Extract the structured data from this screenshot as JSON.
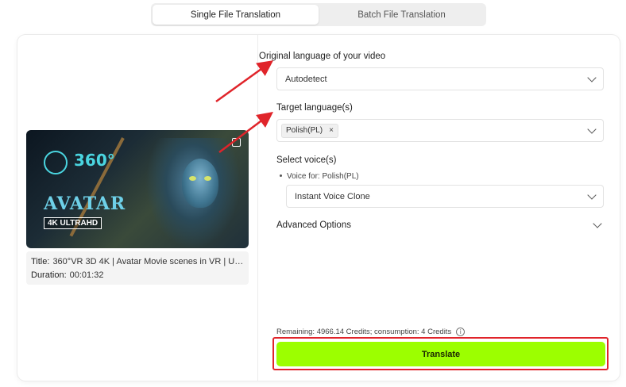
{
  "tabs": [
    {
      "label": "Single File Translation",
      "active": true
    },
    {
      "label": "Batch File Translation",
      "active": false
    }
  ],
  "video": {
    "thumb_text_360": "360°",
    "thumb_logo": "AVATAR",
    "thumb_badge": "4K ULTRAHD",
    "title_label": "Title:",
    "title_value": "360°VR 3D 4K | Avatar Movie scenes in VR | Under...",
    "duration_label": "Duration:",
    "duration_value": "00:01:32"
  },
  "form": {
    "original_language_label": "Original language of your video",
    "original_language_value": "Autodetect",
    "target_language_label": "Target language(s)",
    "target_chip": "Polish(PL)",
    "chip_remove": "×",
    "select_voice_label": "Select voice(s)",
    "voice_for": "Voice for: Polish(PL)",
    "voice_value": "Instant Voice Clone",
    "advanced_options": "Advanced Options"
  },
  "footer": {
    "remaining": "Remaining: 4966.14 Credits; consumption: 4 Credits",
    "info_glyph": "i",
    "translate_label": "Translate"
  },
  "colors": {
    "accent": "#9cff00",
    "annotation_red": "#e0242a"
  }
}
